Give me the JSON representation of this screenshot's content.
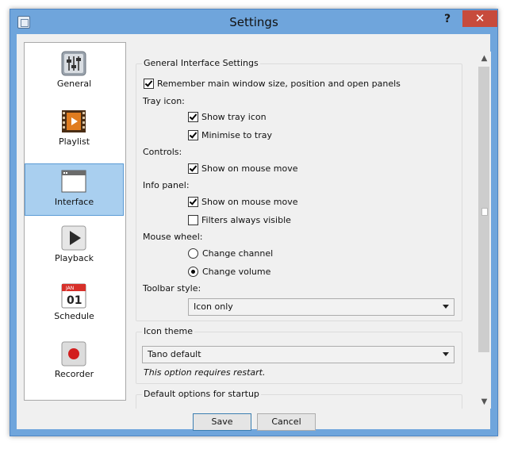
{
  "window": {
    "title": "Settings",
    "help_label": "?",
    "close_label": "✕"
  },
  "sidebar": {
    "items": [
      {
        "label": "General",
        "icon": "equalizer-sliders-icon"
      },
      {
        "label": "Playlist",
        "icon": "film-strip-icon"
      },
      {
        "label": "Interface",
        "icon": "window-icon",
        "selected": true
      },
      {
        "label": "Playback",
        "icon": "play-icon"
      },
      {
        "label": "Schedule",
        "icon": "calendar-icon",
        "calendar_month": "JAN",
        "calendar_day": "01"
      },
      {
        "label": "Recorder",
        "icon": "record-icon"
      }
    ]
  },
  "general_group": {
    "title": "General Interface Settings",
    "remember": {
      "label": "Remember main window size, position and open panels",
      "checked": true
    },
    "tray_label": "Tray icon:",
    "show_tray": {
      "label": "Show tray icon",
      "checked": true
    },
    "minimise_tray": {
      "label": "Minimise to tray",
      "checked": true
    },
    "controls_label": "Controls:",
    "controls_mouse": {
      "label": "Show on mouse move",
      "checked": true
    },
    "info_label": "Info panel:",
    "info_mouse": {
      "label": "Show on mouse move",
      "checked": true
    },
    "filters": {
      "label": "Filters always visible",
      "checked": false
    },
    "wheel_label": "Mouse wheel:",
    "wheel_channel": {
      "label": "Change channel",
      "checked": false
    },
    "wheel_volume": {
      "label": "Change volume",
      "checked": true
    },
    "toolbar_label": "Toolbar style:",
    "toolbar_value": "Icon only"
  },
  "theme_group": {
    "title": "Icon theme",
    "value": "Tano default",
    "note": "This option requires restart."
  },
  "startup_group": {
    "title": "Default options for startup"
  },
  "buttons": {
    "save": "Save",
    "cancel": "Cancel"
  }
}
